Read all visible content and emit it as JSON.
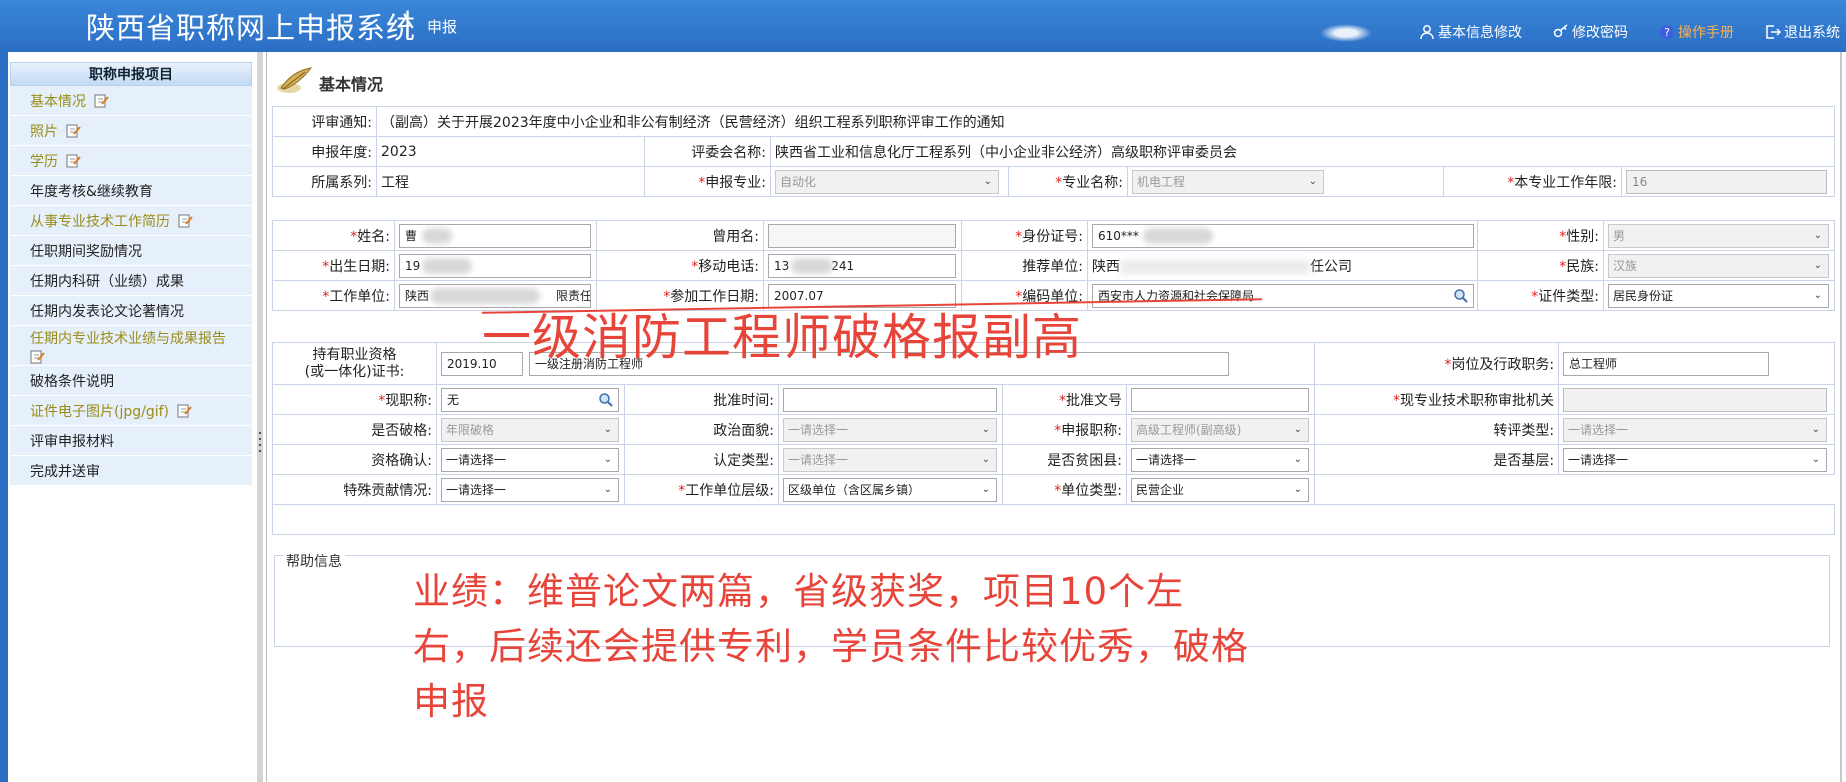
{
  "header": {
    "title": "陕西省职称网上申报系统",
    "separator": "|",
    "subtitle": "申报",
    "links": {
      "basic_info": "基本信息修改",
      "change_password": "修改密码",
      "manual": "操作手册",
      "logout": "退出系统"
    }
  },
  "sidebar": {
    "heading": "职称申报项目",
    "items": [
      {
        "label": "基本情况"
      },
      {
        "label": "照片"
      },
      {
        "label": "学历"
      },
      {
        "label": "年度考核&继续教育"
      },
      {
        "label": "从事专业技术工作简历"
      },
      {
        "label": "任职期间奖励情况"
      },
      {
        "label": "任期内科研（业绩）成果"
      },
      {
        "label": "任期内发表论文论著情况"
      },
      {
        "label": "任期内专业技术业绩与成果报告"
      },
      {
        "label": "破格条件说明"
      },
      {
        "label": "证件电子图片(jpg/gif)"
      },
      {
        "label": "评审申报材料"
      },
      {
        "label": "完成并送审"
      }
    ]
  },
  "page": {
    "title": "基本情况"
  },
  "review": {
    "notice_label": "评审通知:",
    "notice_value": "（副高）关于开展2023年度中小企业和非公有制经济（民营经济）组织工程系列职称评审工作的通知",
    "year_label": "申报年度:",
    "year_value": "2023",
    "committee_label": "评委会名称:",
    "committee_value": "陕西省工业和信息化厅工程系列（中小企业非公经济）高级职称评审委员会",
    "series_label": "所属系列:",
    "series_value": "工程",
    "major_label": "申报专业:",
    "major_value": "自动化",
    "specialty_label": "专业名称:",
    "specialty_value": "机电工程",
    "years_label": "本专业工作年限:",
    "years_value": "16"
  },
  "person": {
    "name_label": "姓名:",
    "name_value": "曹",
    "alias_label": "曾用名:",
    "alias_value": "",
    "id_label": "身份证号:",
    "id_value": "610***",
    "gender_label": "性别:",
    "gender_value": "男",
    "birth_label": "出生日期:",
    "birth_value": "19",
    "mobile_label": "移动电话:",
    "mobile_value_a": "13",
    "mobile_value_b": "241",
    "recommend_label": "推荐单位:",
    "recommend_value_a": "陕西",
    "recommend_value_b": "任公司",
    "nation_label": "民族:",
    "nation_value": "汉族",
    "employer_label": "工作单位:",
    "employer_value_a": "陕西",
    "employer_value_b": "限责任",
    "workstart_label": "参加工作日期:",
    "workstart_value": "2007.07",
    "bianzhi_label": "编码单位:",
    "bianzhi_value": "西安市人力资源和社会保障局",
    "idtype_label": "证件类型:",
    "idtype_value": "居民身份证"
  },
  "qualification": {
    "cert_label_1": "持有职业资格",
    "cert_label_2": "(或一体化)证书:",
    "cert_date": "2019.10",
    "cert_name": "一级注册消防工程师",
    "post_label": "岗位及行政职务:",
    "post_value": "总工程师",
    "current_title_label": "现职称:",
    "current_title_value": "无",
    "approve_time_label": "批准时间:",
    "approve_time_value": "",
    "approve_doc_label": "批准文号",
    "approve_doc_value": "",
    "approve_org_label": "现专业技术职称审批机关",
    "approve_org_value": "",
    "exception_label": "是否破格:",
    "exception_value": "年限破格",
    "politics_label": "政治面貌:",
    "politics_value": "一请选择一",
    "apply_title_label": "申报职称:",
    "apply_title_value": "高级工程师(副高级)",
    "transfer_label": "转评类型:",
    "transfer_value": "一请选择一",
    "qual_confirm_label": "资格确认:",
    "qual_confirm_value": "一请选择一",
    "recog_label": "认定类型:",
    "recog_value": "一请选择一",
    "poor_label": "是否贫困县:",
    "poor_value": "一请选择一",
    "grassroots_label": "是否基层:",
    "grassroots_value": "一请选择一",
    "special_label": "特殊贡献情况:",
    "special_value": "一请选择一",
    "level_label": "工作单位层级:",
    "level_value": "区级单位（含区属乡镇）",
    "unit_type_label": "单位类型:",
    "unit_type_value": "民营企业"
  },
  "help": {
    "legend": "帮助信息"
  },
  "annotation": {
    "headline": "一级消防工程师破格报副高",
    "body": "业绩：维普论文两篇，省级获奖，项目10个左右，后续还会提供专利，学员条件比较优秀，破格申报",
    "color": "#e8453a"
  },
  "colors": {
    "header": "#2b6fc4",
    "sidebar_bg": "#e6f0fb",
    "required": "#e02020",
    "manual_link": "#ffb14a"
  }
}
